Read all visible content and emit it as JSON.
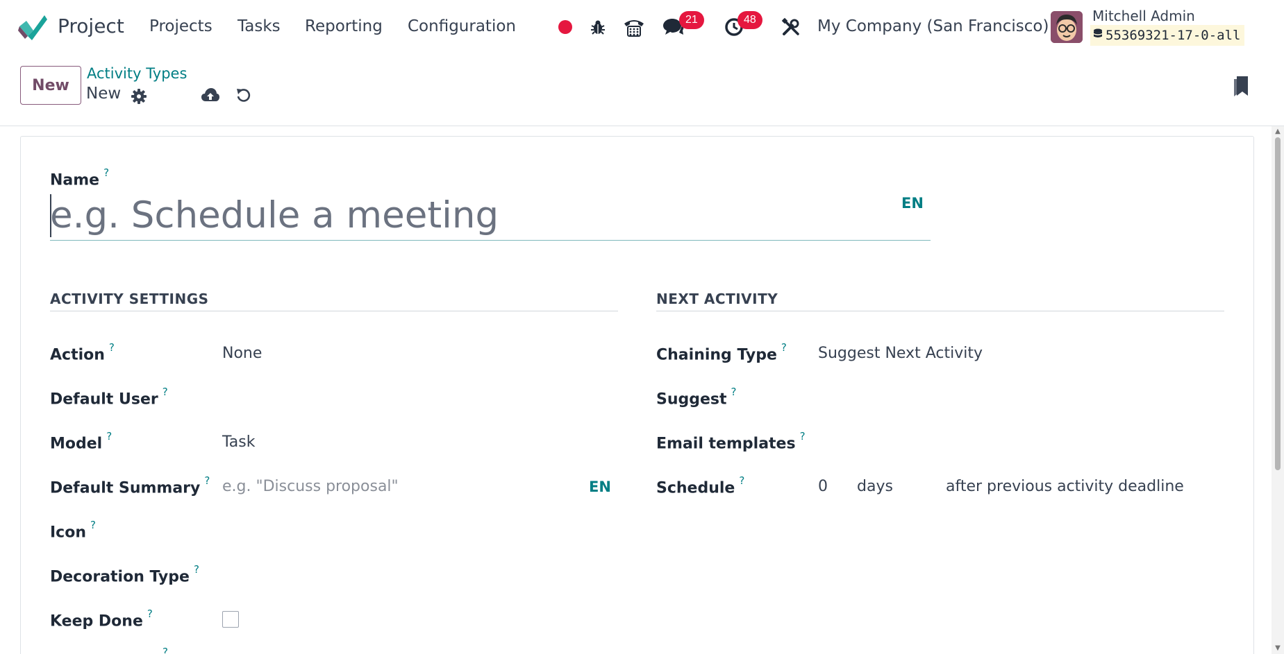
{
  "navbar": {
    "app_name": "Project",
    "menu": [
      "Projects",
      "Tasks",
      "Reporting",
      "Configuration"
    ],
    "messages_count": "21",
    "activities_count": "48",
    "company": "My Company (San Francisco)",
    "user_name": "Mitchell Admin",
    "database": "55369321-17-0-all",
    "colors": {
      "recording_dot": "#e5173f",
      "badge": "#e5173f",
      "brand": "#714b67"
    }
  },
  "control": {
    "new_label": "New",
    "breadcrumb_parent": "Activity Types",
    "breadcrumb_current": "New"
  },
  "form": {
    "name_label": "Name",
    "name_placeholder": "e.g. Schedule a meeting",
    "lang": "EN",
    "help_mark": "?",
    "activity_settings": {
      "title": "ACTIVITY SETTINGS",
      "action_label": "Action",
      "action_value": "None",
      "default_user_label": "Default User",
      "model_label": "Model",
      "model_value": "Task",
      "default_summary_label": "Default Summary",
      "default_summary_placeholder": "e.g. \"Discuss proposal\"",
      "icon_label": "Icon",
      "decoration_type_label": "Decoration Type",
      "keep_done_label": "Keep Done",
      "keep_done_checked": false
    },
    "next_activity": {
      "title": "NEXT ACTIVITY",
      "chaining_type_label": "Chaining Type",
      "chaining_type_value": "Suggest Next Activity",
      "suggest_label": "Suggest",
      "email_templates_label": "Email templates",
      "schedule_label": "Schedule",
      "schedule_delay": "0",
      "schedule_unit": "days",
      "schedule_from": "after previous activity deadline"
    }
  }
}
